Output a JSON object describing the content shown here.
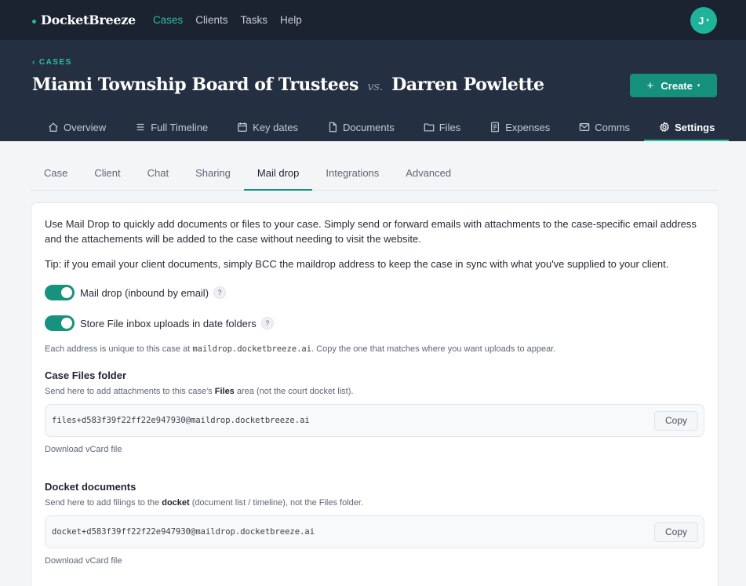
{
  "app": {
    "name": "DocketBreeze"
  },
  "topnav": {
    "items": [
      {
        "label": "Cases",
        "active": true
      },
      {
        "label": "Clients"
      },
      {
        "label": "Tasks"
      },
      {
        "label": "Help"
      }
    ]
  },
  "user": {
    "initial": "J"
  },
  "breadcrumb": {
    "label": "CASES"
  },
  "case": {
    "plaintiff": "Miami Township Board of Trustees",
    "vs": "vs.",
    "defendant": "Darren Powlette"
  },
  "create": {
    "label": "Create"
  },
  "case_tabs": [
    {
      "label": "Overview",
      "icon": "home-icon"
    },
    {
      "label": "Full Timeline",
      "icon": "list-icon"
    },
    {
      "label": "Key dates",
      "icon": "calendar-icon"
    },
    {
      "label": "Documents",
      "icon": "document-icon"
    },
    {
      "label": "Files",
      "icon": "folder-icon"
    },
    {
      "label": "Expenses",
      "icon": "receipt-icon"
    },
    {
      "label": "Comms",
      "icon": "mail-icon"
    },
    {
      "label": "Settings",
      "icon": "gear-icon",
      "active": true
    }
  ],
  "settings_tabs": [
    {
      "label": "Case"
    },
    {
      "label": "Client"
    },
    {
      "label": "Chat"
    },
    {
      "label": "Sharing"
    },
    {
      "label": "Mail drop",
      "active": true
    },
    {
      "label": "Integrations"
    },
    {
      "label": "Advanced"
    }
  ],
  "maildrop": {
    "intro": "Use Mail Drop to quickly add documents or files to your case. Simply send or forward emails with attachments to the case-specific email address and the attachements will be added to the case without needing to visit the website.",
    "tip": "Tip: if you email your client documents, simply BCC the maildrop address to keep the case in sync with what you've supplied to your client.",
    "toggle_inbound": {
      "label": "Mail drop (inbound by email)",
      "on": true,
      "help": "?"
    },
    "toggle_folders": {
      "label": "Store File inbox uploads in date folders",
      "on": true,
      "help": "?"
    },
    "unique_prefix": "Each address is unique to this case at ",
    "unique_domain": "maildrop.docketbreeze.ai",
    "unique_suffix": ". Copy the one that matches where you want uploads to appear.",
    "files": {
      "title": "Case Files folder",
      "desc_prefix": "Send here to add attachments to this case's ",
      "desc_bold": "Files",
      "desc_suffix": " area (not the court docket list).",
      "address": "files+d583f39f22ff22e947930@maildrop.docketbreeze.ai",
      "copy_label": "Copy",
      "vcard_label": "Download vCard file"
    },
    "docket": {
      "title": "Docket documents",
      "desc_prefix": "Send here to add filings to the ",
      "desc_bold": "docket",
      "desc_suffix": " (document list / timeline), not the Files folder.",
      "address": "docket+d583f39ff22f22e947930@maildrop.docketbreeze.ai",
      "copy_label": "Copy",
      "vcard_label": "Download vCard file"
    }
  },
  "colors": {
    "accent": "#16927f",
    "nav_bg": "#1b2230",
    "header_bg": "#243041"
  }
}
